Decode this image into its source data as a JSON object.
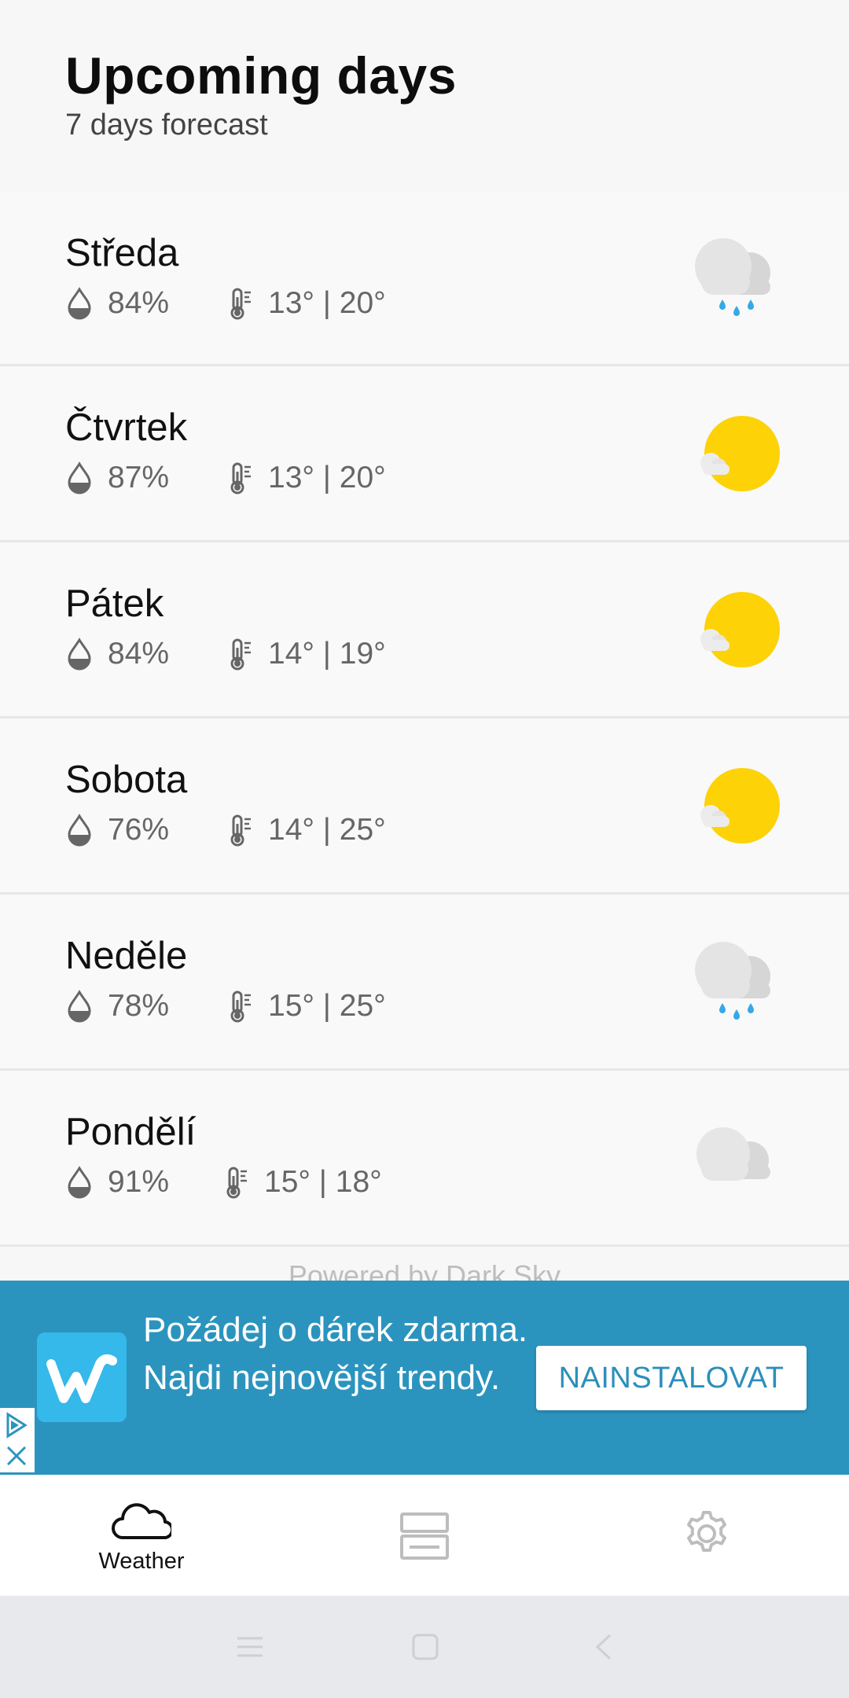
{
  "header": {
    "title": "Upcoming days",
    "subtitle": "7 days forecast"
  },
  "days": [
    {
      "name": "Středa",
      "humidity": "84%",
      "temps": "13° | 20°",
      "icon": "rain-cloud-icon"
    },
    {
      "name": "Čtvrtek",
      "humidity": "87%",
      "temps": "13° | 20°",
      "icon": "sun-small-cloud-icon"
    },
    {
      "name": "Pátek",
      "humidity": "84%",
      "temps": "14° | 19°",
      "icon": "sun-small-cloud-icon"
    },
    {
      "name": "Sobota",
      "humidity": "76%",
      "temps": "14° | 25°",
      "icon": "sun-small-cloud-icon"
    },
    {
      "name": "Neděle",
      "humidity": "78%",
      "temps": "15° | 25°",
      "icon": "rain-cloud-icon"
    },
    {
      "name": "Pondělí",
      "humidity": "91%",
      "temps": "15° | 18°",
      "icon": "cloud-icon"
    }
  ],
  "footer": {
    "powered_by": "Powered by Dark Sky"
  },
  "ad": {
    "text": "Požádej o dárek zdarma. Najdi nejnovější trendy.",
    "button": "NAINSTALOVAT",
    "brand_color": "#2b94be"
  },
  "bottom_nav": {
    "items": [
      {
        "label": "Weather",
        "icon": "cloud-outline-icon",
        "active": true
      },
      {
        "label": "",
        "icon": "widgets-icon",
        "active": false
      },
      {
        "label": "",
        "icon": "gear-icon",
        "active": false
      }
    ]
  },
  "colors": {
    "sun": "#fdd207",
    "rain_drop": "#36a8e6",
    "cloud": "#e0e0e0"
  }
}
